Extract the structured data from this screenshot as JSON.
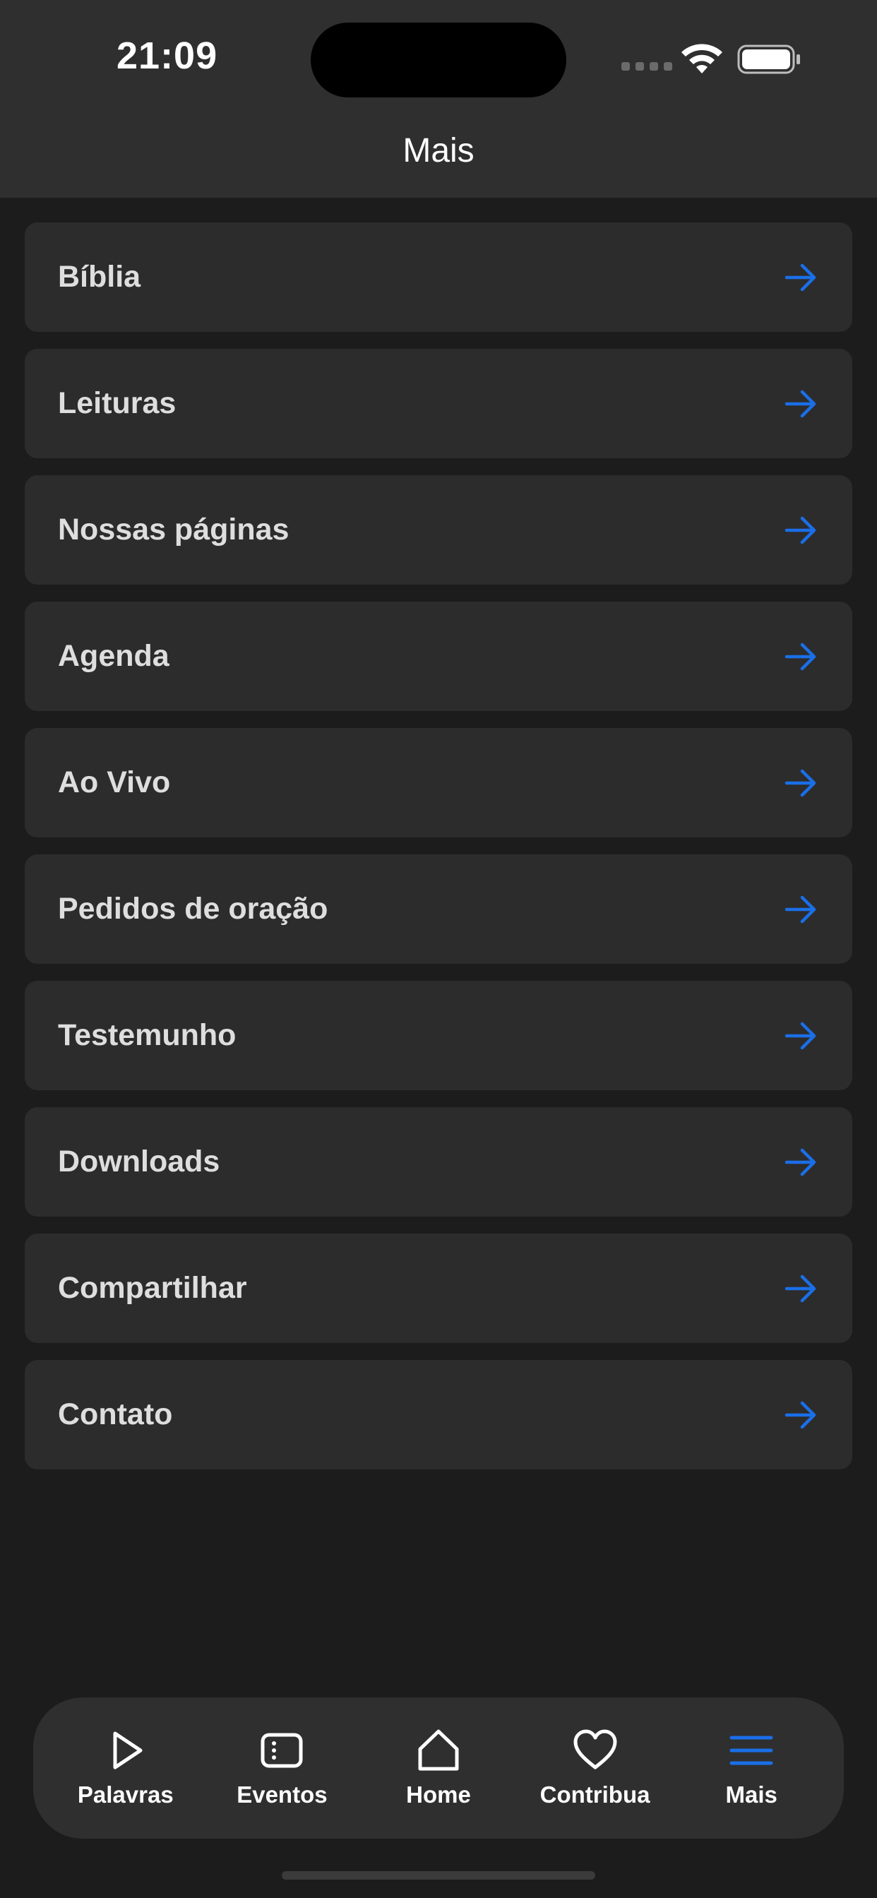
{
  "status_bar": {
    "time": "21:09"
  },
  "header": {
    "title": "Mais"
  },
  "menu": {
    "items": [
      {
        "label": "Bíblia"
      },
      {
        "label": "Leituras"
      },
      {
        "label": "Nossas páginas"
      },
      {
        "label": "Agenda"
      },
      {
        "label": "Ao Vivo"
      },
      {
        "label": "Pedidos de oração"
      },
      {
        "label": "Testemunho"
      },
      {
        "label": "Downloads"
      },
      {
        "label": "Compartilhar"
      },
      {
        "label": "Contato"
      }
    ],
    "arrow_icon": "arrow-right-icon"
  },
  "tab_bar": {
    "tabs": [
      {
        "label": "Palavras",
        "icon": "play-icon"
      },
      {
        "label": "Eventos",
        "icon": "ticket-icon"
      },
      {
        "label": "Home",
        "icon": "home-icon"
      },
      {
        "label": "Contribua",
        "icon": "heart-icon"
      },
      {
        "label": "Mais",
        "icon": "menu-icon",
        "active": true
      }
    ]
  },
  "colors": {
    "accent": "#1a6fe8",
    "background": "#1c1c1c",
    "header": "#2f2f2f",
    "card": "#2c2c2c"
  }
}
